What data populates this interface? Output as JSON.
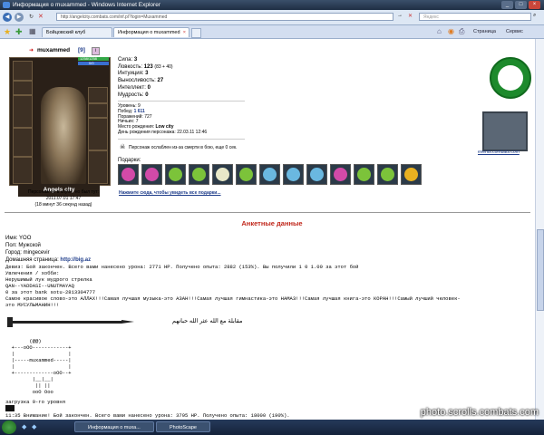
{
  "window": {
    "title": "Информация о muxammed - Windows Internet Explorer",
    "url": "http://angelcity.combats.com/inf.pl?login=Muxammed",
    "search_placeholder": "Яндекс"
  },
  "tabs": [
    {
      "label": "Бойцовский клуб"
    },
    {
      "label": "Информация о muxammed"
    }
  ],
  "toolbar": {
    "page": "Страница",
    "tools": "Сервис"
  },
  "character": {
    "nick": "muxammed",
    "level": "[9]",
    "hp": "1258/1258",
    "mana": "0/0",
    "city": "Angels city",
    "location": "Персонаж не в клубе, но был тут:",
    "last_seen": "2011.07.01 17:47",
    "ago": "(18 минут 36 секунд назад)"
  },
  "stats": [
    {
      "label": "Сила:",
      "value": "3"
    },
    {
      "label": "Ловкость:",
      "value": "123",
      "bonus": "(83 + 40)"
    },
    {
      "label": "Интуиция:",
      "value": "3"
    },
    {
      "label": "Выносливость:",
      "value": "27"
    },
    {
      "label": "Интеллект:",
      "value": "0"
    },
    {
      "label": "Мудрость:",
      "value": "0"
    }
  ],
  "record": [
    {
      "label": "Уровень:",
      "value": "9"
    },
    {
      "label": "Побед:",
      "value": "1 611"
    },
    {
      "label": "Поражений:",
      "value": "727"
    },
    {
      "label": "Ничьих:",
      "value": "7"
    },
    {
      "label": "Место рождения:",
      "value": "Low city"
    },
    {
      "label": "День рождения персонажа:",
      "value": "22.03.11 12:46"
    }
  ],
  "weakness": "Персонаж ослаблен из-за смерти в бою, еще 0 сек.",
  "gifts": {
    "title": "Подарки:",
    "link": "Нажмите сюда, чтобы увидеть все подарки...",
    "colors": [
      "#d24aa8",
      "#d24aa8",
      "#7cc33a",
      "#7cc33a",
      "#e8e8c8",
      "#7cc33a",
      "#6ab8e0",
      "#6ab8e0",
      "#6ab8e0",
      "#d24aa8",
      "#7cc33a",
      "#7cc33a",
      "#e8b020"
    ]
  },
  "logos": {
    "events": "events.combats.com"
  },
  "profile": {
    "heading": "Анкетные данные",
    "name_label": "Имя:",
    "name": "YOO",
    "sex_label": "Пол:",
    "sex": "Мужской",
    "city_label": "Город:",
    "city": "mingecevir",
    "homepage_label": "Домашняя страница:",
    "homepage": "http://big.az",
    "motto_label": "Девиз:",
    "motto": "Бой закончен. Всего вами нанесено урона: 2771 HP. Получено опыта: 2882 (153%). Вы получили 1 0 1.00 за этот бой",
    "hobby_label": "Увлечения / хобби:",
    "hobby": [
      "Нерушимый лук мудрого стрелка",
      "QAN--YADDASI--UNUTMAYAQ",
      "0 за этот bank sotu-2813304777",
      "Самое красивое слово-это АЛЛАХ!!!Самая лучшая музыка-это АЗАН!!!Самая лучшая гимнастика-это НАМАЗ!!!Самая лучшая книга-это КОРАН!!!Самый лучший человек-",
      "это МУСУЛЬМАНИН!!!"
    ],
    "sword_text": "مقابلة مع الله عثر الله حبانهم",
    "ascii": "        (@@)\n  +---oOO------------+\n  |                  |\n  |-----muxammed-----|\n  |                  |\n  +-------------oOO--+\n         |__|__|\n          || ||\n         ooO Ooo",
    "footer1": "загрузка 9-го уровня",
    "footer2": "11:35 Внимание! Бой закончен. Всего вами нанесено урона: 3795 HP. Получено опыта: 18000 (190%)."
  },
  "taskbar": {
    "task1": "Информация о muxa...",
    "task2": "PhotoScape"
  },
  "watermark": "photo.scrolls.combats.com"
}
